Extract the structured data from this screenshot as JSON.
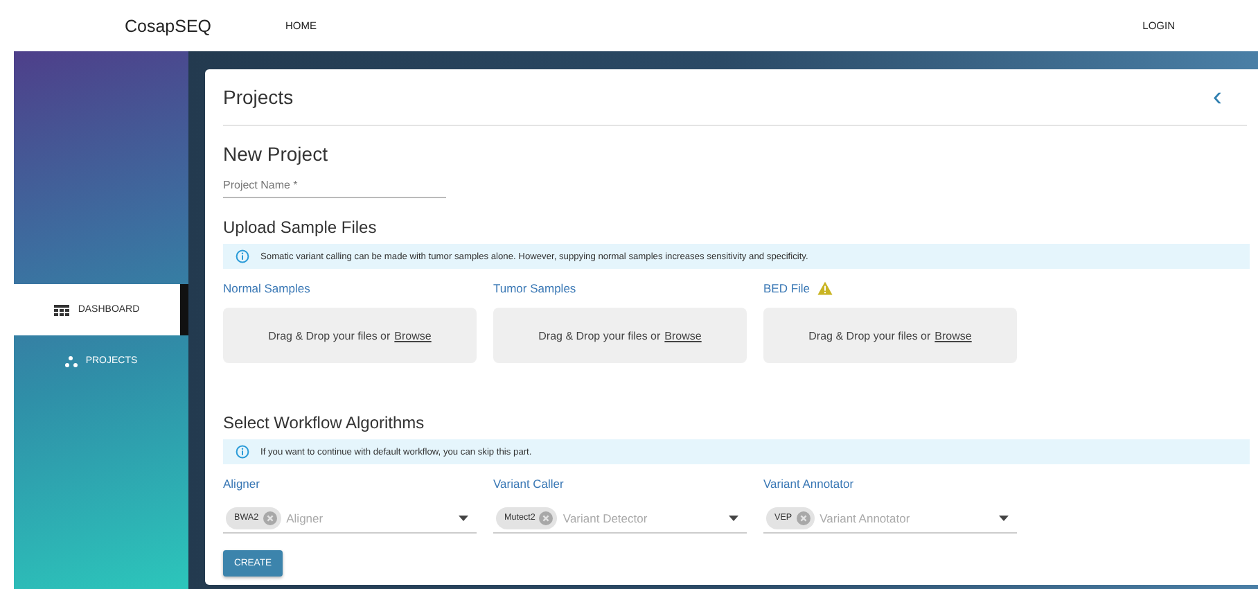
{
  "header": {
    "brand": "CosapSEQ",
    "nav": [
      {
        "label": "HOME"
      }
    ],
    "login": "LOGIN"
  },
  "sidebar": {
    "items": [
      {
        "label": "DASHBOARD",
        "selected": true
      },
      {
        "label": "PROJECTS",
        "selected": false
      }
    ]
  },
  "card": {
    "title": "Projects",
    "back": "‹",
    "new_project": {
      "heading": "New Project",
      "project_name": {
        "placeholder": "Project Name *"
      }
    },
    "upload": {
      "heading": "Upload Sample Files",
      "info": "Somatic variant calling can be made with tumor samples alone. However, suppying normal samples increases sensitivity and specificity.",
      "zones": [
        {
          "label": "Normal Samples",
          "warning": false,
          "drop_text": "Drag & Drop your files or",
          "browse": "Browse"
        },
        {
          "label": "Tumor Samples",
          "warning": false,
          "drop_text": "Drag & Drop your files or",
          "browse": "Browse"
        },
        {
          "label": "BED File",
          "warning": true,
          "drop_text": "Drag & Drop your files or",
          "browse": "Browse"
        }
      ]
    },
    "workflow": {
      "heading": "Select Workflow Algorithms",
      "info": "If you want to continue with default workflow, you can skip this part.",
      "selects": [
        {
          "label": "Aligner",
          "chip": "BWA2",
          "placeholder": "Aligner"
        },
        {
          "label": "Variant Caller",
          "chip": "Mutect2",
          "placeholder": "Variant Detector"
        },
        {
          "label": "Variant Annotator",
          "chip": "VEP",
          "placeholder": "Variant Annotator"
        }
      ]
    },
    "create_button": "CREATE"
  }
}
